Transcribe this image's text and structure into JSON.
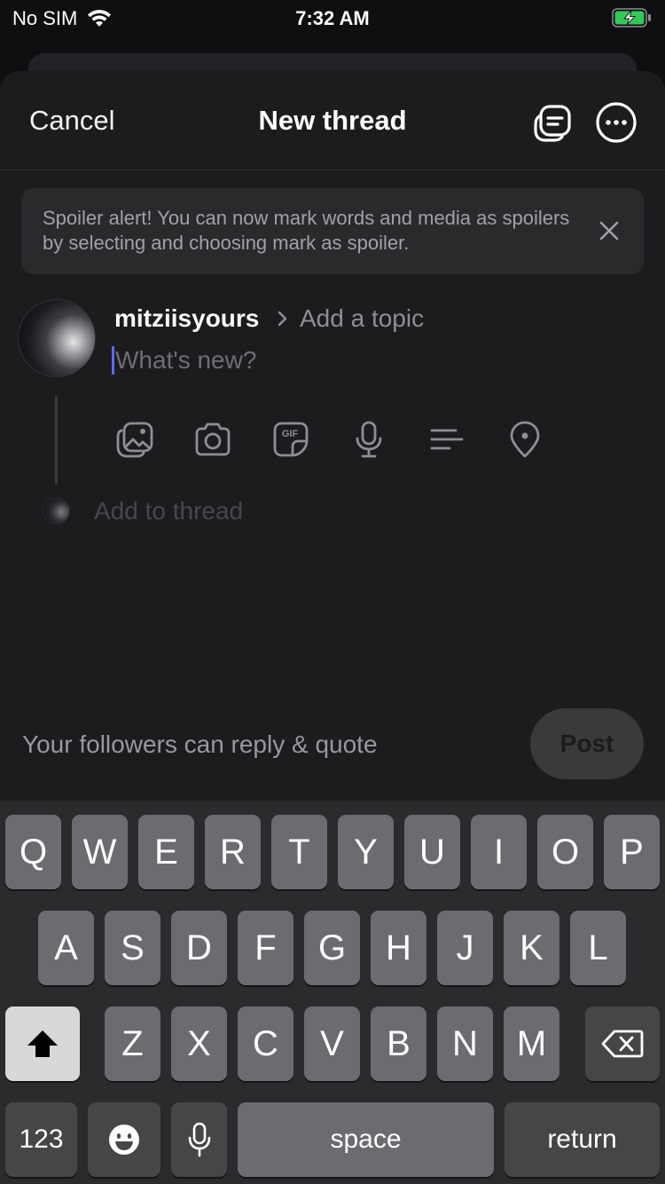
{
  "status": {
    "carrier": "No SIM",
    "time": "7:32 AM"
  },
  "header": {
    "cancel_label": "Cancel",
    "title": "New thread"
  },
  "banner": {
    "text": "Spoiler alert! You can now mark words and media as spoilers by selecting and choosing mark as spoiler."
  },
  "composer": {
    "username": "mitziisyours",
    "topic_placeholder": "Add a topic",
    "placeholder": "What's new?",
    "add_to_thread": "Add to thread",
    "tools": [
      "gallery-icon",
      "camera-icon",
      "gif-icon",
      "microphone-icon",
      "poll-icon",
      "location-icon"
    ]
  },
  "footer": {
    "reply_setting": "Your followers can reply & quote",
    "post_label": "Post"
  },
  "keyboard": {
    "row1": [
      "Q",
      "W",
      "E",
      "R",
      "T",
      "Y",
      "U",
      "I",
      "O",
      "P"
    ],
    "row2": [
      "A",
      "S",
      "D",
      "F",
      "G",
      "H",
      "J",
      "K",
      "L"
    ],
    "row3": [
      "Z",
      "X",
      "C",
      "V",
      "B",
      "N",
      "M"
    ],
    "numbers_label": "123",
    "space_label": "space",
    "return_label": "return"
  },
  "colors": {
    "background": "#1c1c1e",
    "accent_caret": "#5b6cff",
    "battery_green": "#34c759"
  }
}
